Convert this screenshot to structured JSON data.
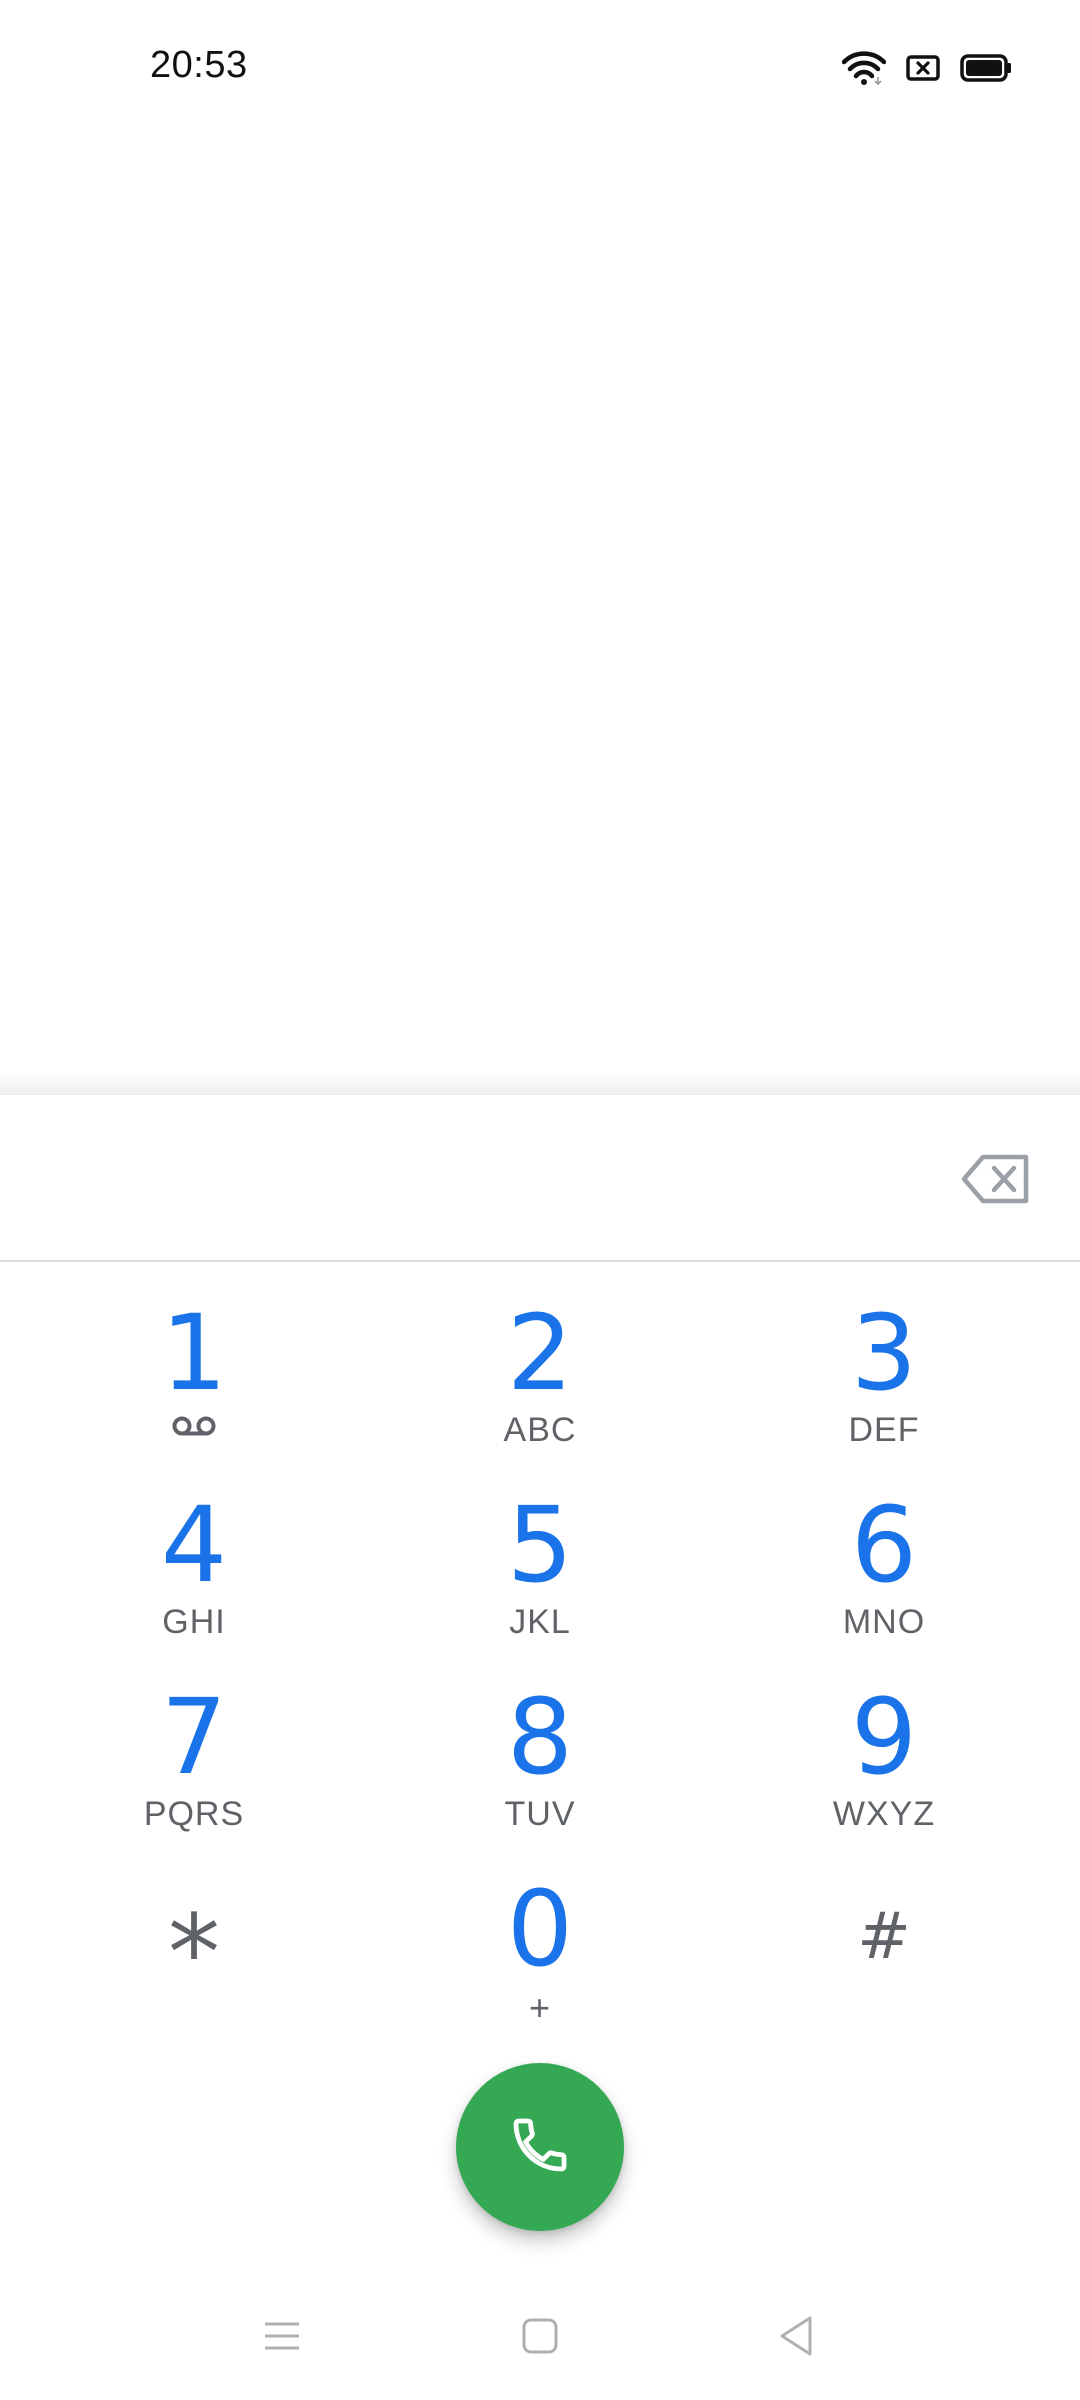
{
  "status_bar": {
    "time": "20:53",
    "icons": [
      "wifi-icon",
      "no-sim-icon",
      "battery-icon"
    ]
  },
  "dialer": {
    "number_value": "",
    "backspace_icon": "backspace-icon",
    "keys": [
      {
        "digit": "1",
        "letters": "",
        "icon": "voicemail-icon"
      },
      {
        "digit": "2",
        "letters": "ABC"
      },
      {
        "digit": "3",
        "letters": "DEF"
      },
      {
        "digit": "4",
        "letters": "GHI"
      },
      {
        "digit": "5",
        "letters": "JKL"
      },
      {
        "digit": "6",
        "letters": "MNO"
      },
      {
        "digit": "7",
        "letters": "PQRS"
      },
      {
        "digit": "8",
        "letters": "TUV"
      },
      {
        "digit": "9",
        "letters": "WXYZ"
      },
      {
        "digit": "*",
        "letters": ""
      },
      {
        "digit": "0",
        "letters": "+"
      },
      {
        "digit": "#",
        "letters": ""
      }
    ],
    "call_icon": "phone-icon"
  },
  "nav_bar": {
    "icons": [
      "menu-icon",
      "home-icon",
      "back-icon"
    ]
  },
  "colors": {
    "accent": "#1a73e8",
    "call_green": "#34a853",
    "secondary_text": "#5f6368"
  }
}
